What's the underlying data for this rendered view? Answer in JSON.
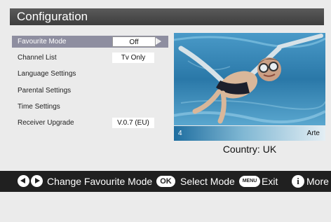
{
  "header": {
    "title": "Configuration"
  },
  "menu": {
    "items": [
      {
        "label": "Favourite Mode",
        "value": "Off",
        "selected": true
      },
      {
        "label": "Channel List",
        "value": "Tv Only"
      },
      {
        "label": "Language Settings"
      },
      {
        "label": "Parental Settings"
      },
      {
        "label": "Time Settings"
      },
      {
        "label": "Receiver Upgrade",
        "value": "V.0.7 (EU)"
      }
    ]
  },
  "preview": {
    "channel_number": "4",
    "channel_name": "Arte",
    "country_label": "Country:",
    "country_value": "UK"
  },
  "help": {
    "change_label": "Change Favourite Mode",
    "ok_key": "OK",
    "select_label": "Select Mode",
    "menu_key": "MENU",
    "exit_label": "Exit",
    "more_label": "More"
  },
  "colors": {
    "background": "#ebebeb",
    "title_bar": "#4a4a4a",
    "selected_row": "#8e8ea0",
    "help_bar": "#202020",
    "channel_bar_start": "#1f6ea0"
  }
}
